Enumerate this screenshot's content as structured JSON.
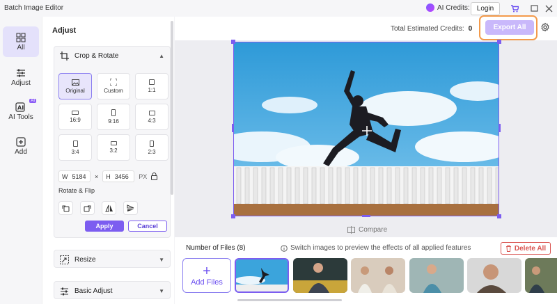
{
  "window": {
    "title": "Batch Image Editor",
    "ai_credits_label": "AI Credits:",
    "login_label": "Login"
  },
  "rail": {
    "items": [
      {
        "label": "All",
        "icon": "grid-icon",
        "active": true
      },
      {
        "label": "Adjust",
        "icon": "sliders-icon",
        "active": false
      },
      {
        "label": "AI Tools",
        "icon": "ai-tools-icon",
        "badge": "AI",
        "active": false
      },
      {
        "label": "Add",
        "icon": "add-box-icon",
        "active": false
      }
    ]
  },
  "panel": {
    "title": "Adjust",
    "crop": {
      "title": "Crop & Rotate",
      "ratios": [
        "Original",
        "Custom",
        "1:1",
        "16:9",
        "9:16",
        "4:3",
        "3:4",
        "3:2",
        "2:3"
      ],
      "selected_ratio": "Original",
      "width_label": "W",
      "width_value": "5184",
      "times": "×",
      "height_label": "H",
      "height_value": "3456",
      "unit": "PX",
      "rotate_flip_label": "Rotate & Flip",
      "apply_label": "Apply",
      "cancel_label": "Cancel"
    },
    "resize_label": "Resize",
    "basic_adjust_label": "Basic Adjust"
  },
  "main": {
    "est_credits_label": "Total Estimated Credits:",
    "est_credits_value": "0",
    "export_label": "Export All",
    "compare_label": "Compare",
    "files_count_label": "Number of Files (8)",
    "hint": "Switch images to preview the effects of all applied features",
    "delete_all_label": "Delete All",
    "add_files_label": "Add Files",
    "add_files_plus": "+"
  },
  "colors": {
    "accent": "#7c5df0",
    "export_highlight": "#f39a4b",
    "delete": "#d9534f",
    "sky": "#3aa7de"
  }
}
